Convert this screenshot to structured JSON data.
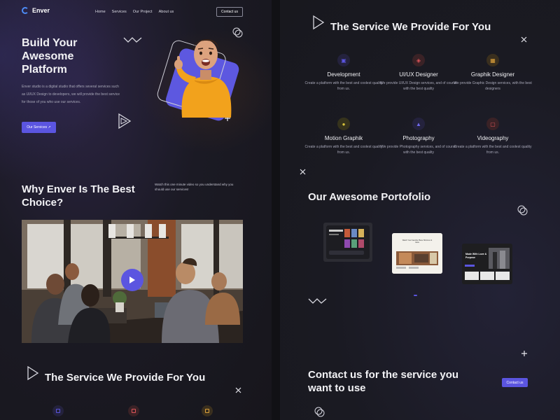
{
  "brand": {
    "name": "Enver",
    "accent": "#5b55e0"
  },
  "nav": {
    "items": [
      "Home",
      "Services",
      "Our Project",
      "About us"
    ],
    "contact_label": "Contact us"
  },
  "hero": {
    "title": "Build Your Awesome Platform",
    "description": "Enver studio is a digital studio that offers several services such as UI/UX Design to developers, we will provide the best service for those of you who use our services.",
    "cta_label": "Our Services ↗"
  },
  "why": {
    "title": "Why Enver Is The Best Choice?",
    "description": "Watch this one minute video so you understand why you should use our services!"
  },
  "services": {
    "title": "The Service We Provide For You",
    "items": [
      {
        "name": "Development",
        "description": "Create a platform with the best and coolest quality from us.",
        "icon": "code-icon",
        "color": "#5b55e0"
      },
      {
        "name": "UI/UX Designer",
        "description": "We provide UI/UX Design services, and of course with the best quality",
        "icon": "layers-icon",
        "color": "#e0555b"
      },
      {
        "name": "Graphik Designer",
        "description": "We provide Graphic Design services, with the best designers",
        "icon": "image-icon",
        "color": "#e0a33b"
      },
      {
        "name": "Motion Graphik",
        "description": "Create a platform with the best and coolest quality from us.",
        "icon": "motion-icon",
        "color": "#d6c23b"
      },
      {
        "name": "Photography",
        "description": "We provide Photography services, and of course with the best quality",
        "icon": "camera-icon",
        "color": "#5b55e0"
      },
      {
        "name": "Videography",
        "description": "Create a platform with the best and coolest quality from us.",
        "icon": "video-icon",
        "color": "#e0555b"
      }
    ]
  },
  "portfolio": {
    "title": "Our Awesome Portofolio",
    "thumb1_text": "Watch Your Favorite Place Shimmer & Glow",
    "thumb2_text": "Made With Love & Purpose"
  },
  "contact": {
    "title": "Contact us for the service you want to use",
    "cta_label": "Contact us"
  }
}
